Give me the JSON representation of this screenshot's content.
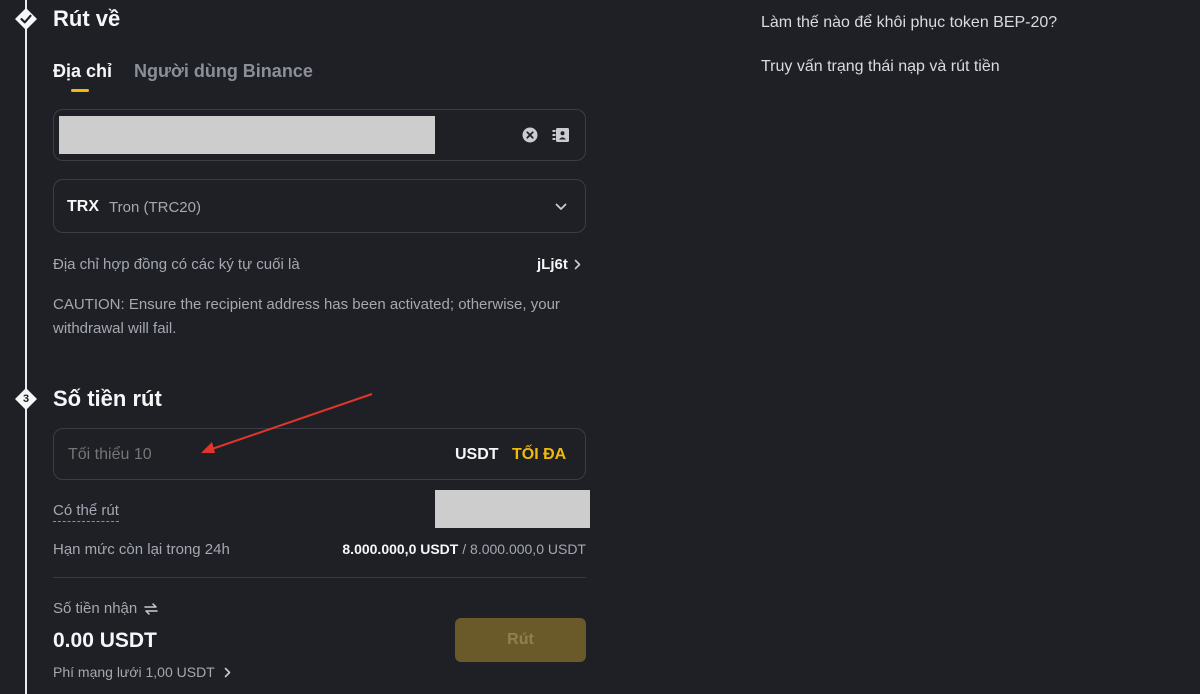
{
  "withdraw_to": {
    "title": "Rút về",
    "tabs": [
      {
        "label": "Địa chỉ",
        "active": true
      },
      {
        "label": "Người dùng Binance",
        "active": false
      }
    ],
    "address_value": "",
    "network": {
      "code": "TRX",
      "name": "Tron (TRC20)"
    },
    "contract_label": "Địa chỉ hợp đồng có các ký tự cuối là",
    "contract_suffix": "jLj6t",
    "caution": "CAUTION: Ensure the recipient address has been activated; otherwise, your withdrawal will fail."
  },
  "amount": {
    "step_number": "3",
    "title": "Số tiền rút",
    "placeholder": "Tối thiểu 10",
    "currency": "USDT",
    "max_label": "TỐI ĐA",
    "available_label": "Có thể rút",
    "limit_label": "Hạn mức còn lại trong 24h",
    "limit_used": "8.000.000,0 USDT",
    "limit_total": " / 8.000.000,0 USDT",
    "receive_label": "Số tiền nhận",
    "receive_value": "0.00 USDT",
    "fee_label": "Phí mạng lưới 1,00 USDT",
    "submit_label": "Rút"
  },
  "sidebar_links": [
    "Làm thế nào để khôi phục token BEP-20?",
    "Truy vấn trạng thái nạp và rút tiền"
  ],
  "colors": {
    "accent": "#f0b90b",
    "background": "#1f2025",
    "annotation_arrow": "#e0342c"
  },
  "icons": [
    "check-icon",
    "clear-icon",
    "address-book-icon",
    "chevron-down-icon",
    "chevron-right-icon",
    "swap-icon"
  ]
}
